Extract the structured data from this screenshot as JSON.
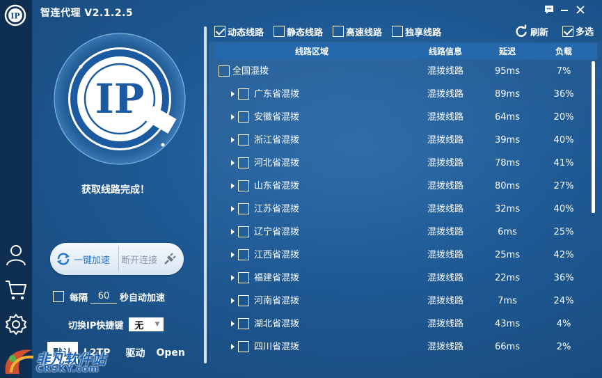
{
  "app": {
    "title": "智连代理 V2.1.2.5"
  },
  "rail": {
    "logo_text": "IP"
  },
  "logo": {
    "text": "IP"
  },
  "status": "获取线路完成！",
  "actions": {
    "connect_label": "一键加速",
    "disconnect_label": "断开连接"
  },
  "auto": {
    "prefix": "每隔",
    "value": "60",
    "suffix": "秒自动加速",
    "checked": false
  },
  "hotkey": {
    "label": "切换IP快捷键",
    "value": "无"
  },
  "protocols": [
    {
      "label": "默认",
      "active": true
    },
    {
      "label": "L2TP",
      "active": false
    },
    {
      "label": "驱动",
      "active": false
    },
    {
      "label": "Open",
      "active": false
    }
  ],
  "watermark": {
    "line1": "非凡软件站",
    "line2": "CRSKY.com"
  },
  "filters": [
    {
      "label": "动态线路",
      "checked": true
    },
    {
      "label": "静态线路",
      "checked": false
    },
    {
      "label": "高速线路",
      "checked": false
    },
    {
      "label": "独享线路",
      "checked": false
    }
  ],
  "toolbar": {
    "refresh_label": "刷新",
    "multi_label": "多选",
    "multi_checked": true
  },
  "table": {
    "headers": {
      "region": "线路区域",
      "info": "线路信息",
      "latency": "延迟",
      "load": "负载"
    },
    "rows": [
      {
        "region": "全国混拨",
        "info": "混拨线路",
        "latency": "95ms",
        "load": "7%",
        "top": true
      },
      {
        "region": "广东省混拨",
        "info": "混拨线路",
        "latency": "89ms",
        "load": "36%"
      },
      {
        "region": "安徽省混拨",
        "info": "混拨线路",
        "latency": "64ms",
        "load": "20%"
      },
      {
        "region": "浙江省混拨",
        "info": "混拨线路",
        "latency": "39ms",
        "load": "40%"
      },
      {
        "region": "河北省混拨",
        "info": "混拨线路",
        "latency": "78ms",
        "load": "41%"
      },
      {
        "region": "山东省混拨",
        "info": "混拨线路",
        "latency": "80ms",
        "load": "27%"
      },
      {
        "region": "江苏省混拨",
        "info": "混拨线路",
        "latency": "32ms",
        "load": "40%"
      },
      {
        "region": "辽宁省混拨",
        "info": "混拨线路",
        "latency": "6ms",
        "load": "25%"
      },
      {
        "region": "江西省混拨",
        "info": "混拨线路",
        "latency": "25ms",
        "load": "42%"
      },
      {
        "region": "福建省混拨",
        "info": "混拨线路",
        "latency": "22ms",
        "load": "36%"
      },
      {
        "region": "河南省混拨",
        "info": "混拨线路",
        "latency": "7ms",
        "load": "24%"
      },
      {
        "region": "湖北省混拨",
        "info": "混拨线路",
        "latency": "43ms",
        "load": "4%"
      },
      {
        "region": "四川省混拨",
        "info": "混拨线路",
        "latency": "66ms",
        "load": "2%"
      }
    ]
  },
  "colors": {
    "accent": "#2b78c8",
    "rail": "#0f2f52",
    "header": "#2569ac"
  }
}
